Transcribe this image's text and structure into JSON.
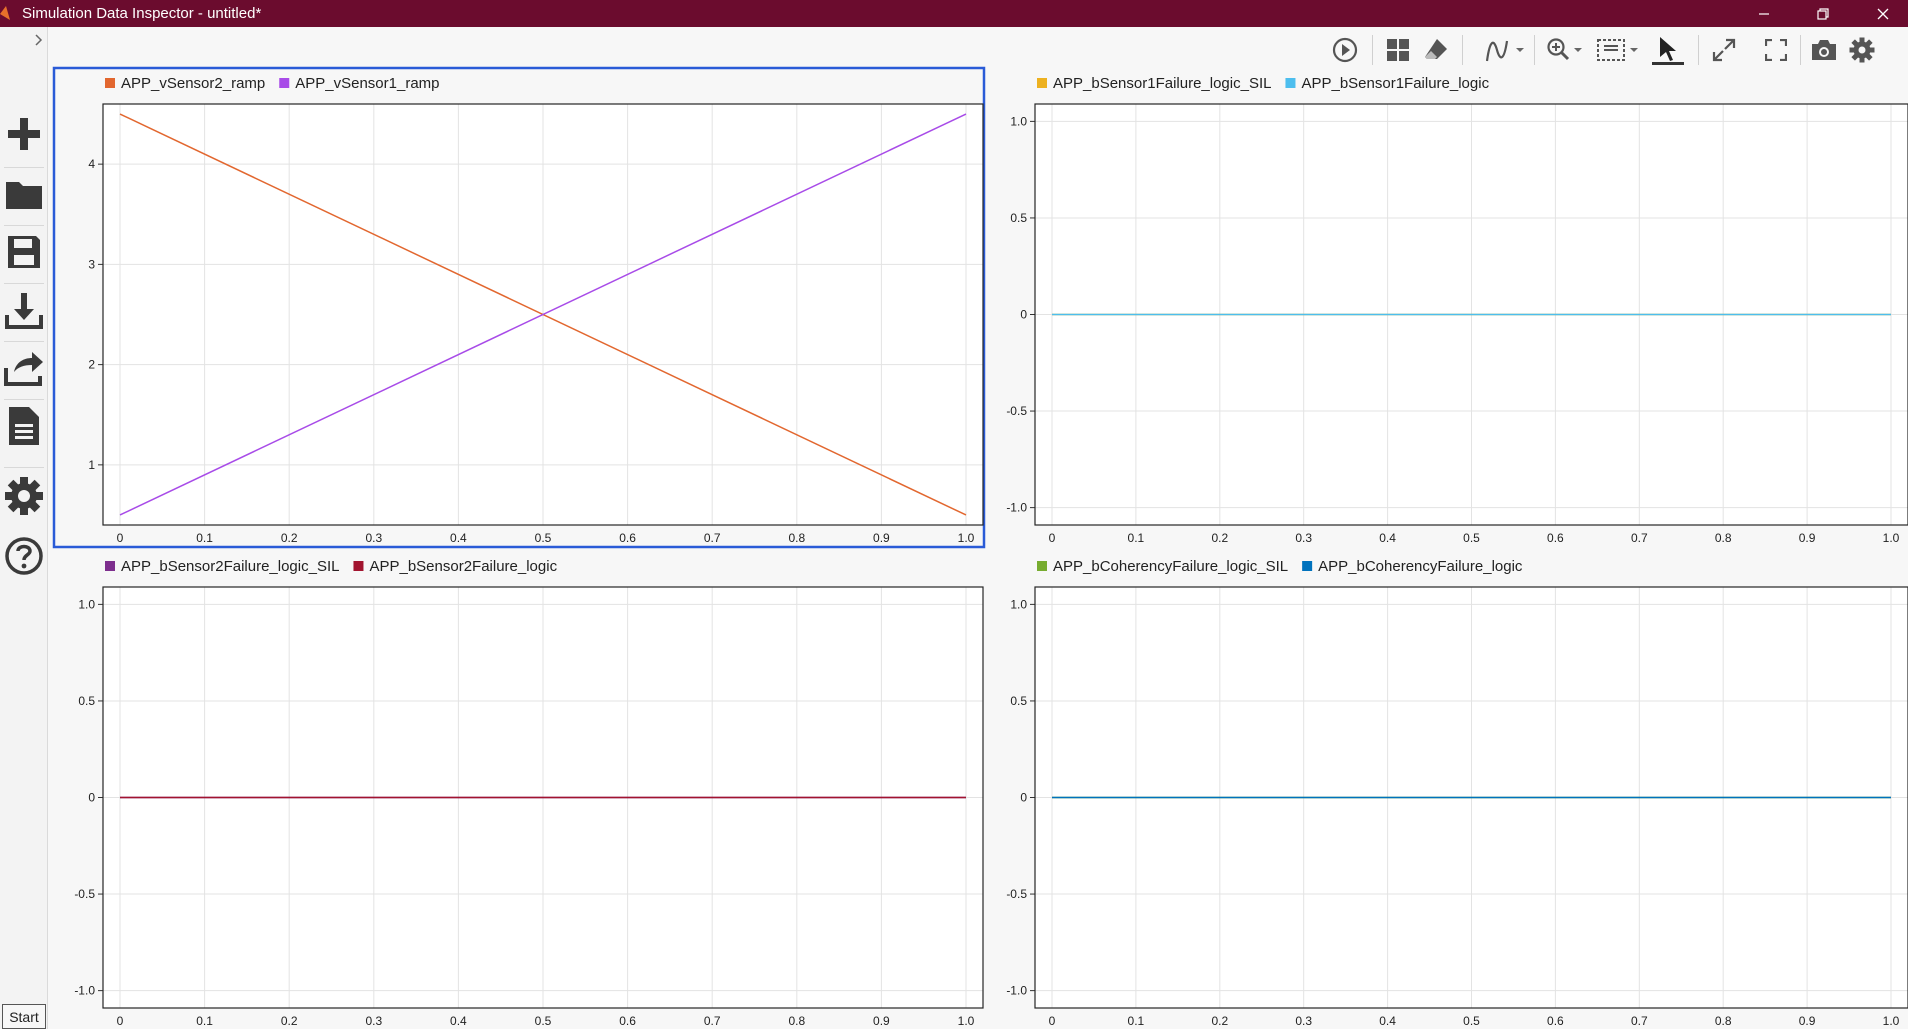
{
  "window": {
    "title": "Simulation Data Inspector - untitled*"
  },
  "sidebar": {
    "expand_icon": "chevron-right-icon",
    "items": [
      {
        "name": "new",
        "icon": "plus-icon"
      },
      {
        "name": "open",
        "icon": "folder-icon"
      },
      {
        "name": "save",
        "icon": "save-icon"
      },
      {
        "name": "import",
        "icon": "download-icon"
      },
      {
        "name": "export",
        "icon": "share-icon"
      },
      {
        "name": "report",
        "icon": "document-icon"
      },
      {
        "name": "preferences",
        "icon": "gear-icon"
      },
      {
        "name": "help",
        "icon": "help-icon"
      }
    ],
    "start_label": "Start"
  },
  "toolbar": {
    "icons": [
      "play-icon",
      "layout-icon",
      "eraser-icon",
      "signal-icon",
      "zoom-in-icon",
      "fit-icon",
      "cursor-icon",
      "expand-icon",
      "fullscreen-icon",
      "camera-icon",
      "settings-icon"
    ]
  },
  "colors": {
    "titlebar": "#6b0c2e",
    "selected_border": "#2a5bd7"
  },
  "chart_data": [
    {
      "type": "line",
      "selected": true,
      "xlim": [
        0,
        1
      ],
      "ylim": [
        0.4,
        4.6
      ],
      "x_ticks": [
        "0",
        "0.1",
        "0.2",
        "0.3",
        "0.4",
        "0.5",
        "0.6",
        "0.7",
        "0.8",
        "0.9",
        "1.0"
      ],
      "y_ticks": [
        "1",
        "2",
        "3",
        "4"
      ],
      "y_tick_values": [
        1,
        2,
        3,
        4
      ],
      "series": [
        {
          "name": "APP_vSensor2_ramp",
          "color": "#e2672f",
          "x": [
            0,
            1
          ],
          "y": [
            4.5,
            0.5
          ]
        },
        {
          "name": "APP_vSensor1_ramp",
          "color": "#a84be8",
          "x": [
            0,
            1
          ],
          "y": [
            0.5,
            4.5
          ]
        }
      ]
    },
    {
      "type": "line",
      "selected": false,
      "xlim": [
        0,
        1
      ],
      "ylim": [
        -1.09,
        1.09
      ],
      "x_ticks": [
        "0",
        "0.1",
        "0.2",
        "0.3",
        "0.4",
        "0.5",
        "0.6",
        "0.7",
        "0.8",
        "0.9",
        "1.0"
      ],
      "y_ticks": [
        "1.0",
        "0.5",
        "0",
        "-0.5",
        "-1.0"
      ],
      "y_tick_values": [
        1,
        0.5,
        0,
        -0.5,
        -1
      ],
      "series": [
        {
          "name": "APP_bSensor1Failure_logic_SIL",
          "color": "#edb120",
          "x": [
            0,
            1
          ],
          "y": [
            0,
            0
          ]
        },
        {
          "name": "APP_bSensor1Failure_logic",
          "color": "#4dbeee",
          "x": [
            0,
            1
          ],
          "y": [
            0,
            0
          ]
        }
      ]
    },
    {
      "type": "line",
      "selected": false,
      "xlim": [
        0,
        1
      ],
      "ylim": [
        -1.09,
        1.09
      ],
      "x_ticks": [
        "0",
        "0.1",
        "0.2",
        "0.3",
        "0.4",
        "0.5",
        "0.6",
        "0.7",
        "0.8",
        "0.9",
        "1.0"
      ],
      "y_ticks": [
        "1.0",
        "0.5",
        "0",
        "-0.5",
        "-1.0"
      ],
      "y_tick_values": [
        1,
        0.5,
        0,
        -0.5,
        -1
      ],
      "series": [
        {
          "name": "APP_bSensor2Failure_logic_SIL",
          "color": "#7e2f8e",
          "x": [
            0,
            1
          ],
          "y": [
            0,
            0
          ]
        },
        {
          "name": "APP_bSensor2Failure_logic",
          "color": "#a2142f",
          "x": [
            0,
            1
          ],
          "y": [
            0,
            0
          ]
        }
      ]
    },
    {
      "type": "line",
      "selected": false,
      "xlim": [
        0,
        1
      ],
      "ylim": [
        -1.09,
        1.09
      ],
      "x_ticks": [
        "0",
        "0.1",
        "0.2",
        "0.3",
        "0.4",
        "0.5",
        "0.6",
        "0.7",
        "0.8",
        "0.9",
        "1.0"
      ],
      "y_ticks": [
        "1.0",
        "0.5",
        "0",
        "-0.5",
        "-1.0"
      ],
      "y_tick_values": [
        1,
        0.5,
        0,
        -0.5,
        -1
      ],
      "series": [
        {
          "name": "APP_bCoherencyFailure_logic_SIL",
          "color": "#77ac30",
          "x": [
            0,
            1
          ],
          "y": [
            0,
            0
          ]
        },
        {
          "name": "APP_bCoherencyFailure_logic",
          "color": "#0072bd",
          "x": [
            0,
            1
          ],
          "y": [
            0,
            0
          ]
        }
      ]
    }
  ]
}
